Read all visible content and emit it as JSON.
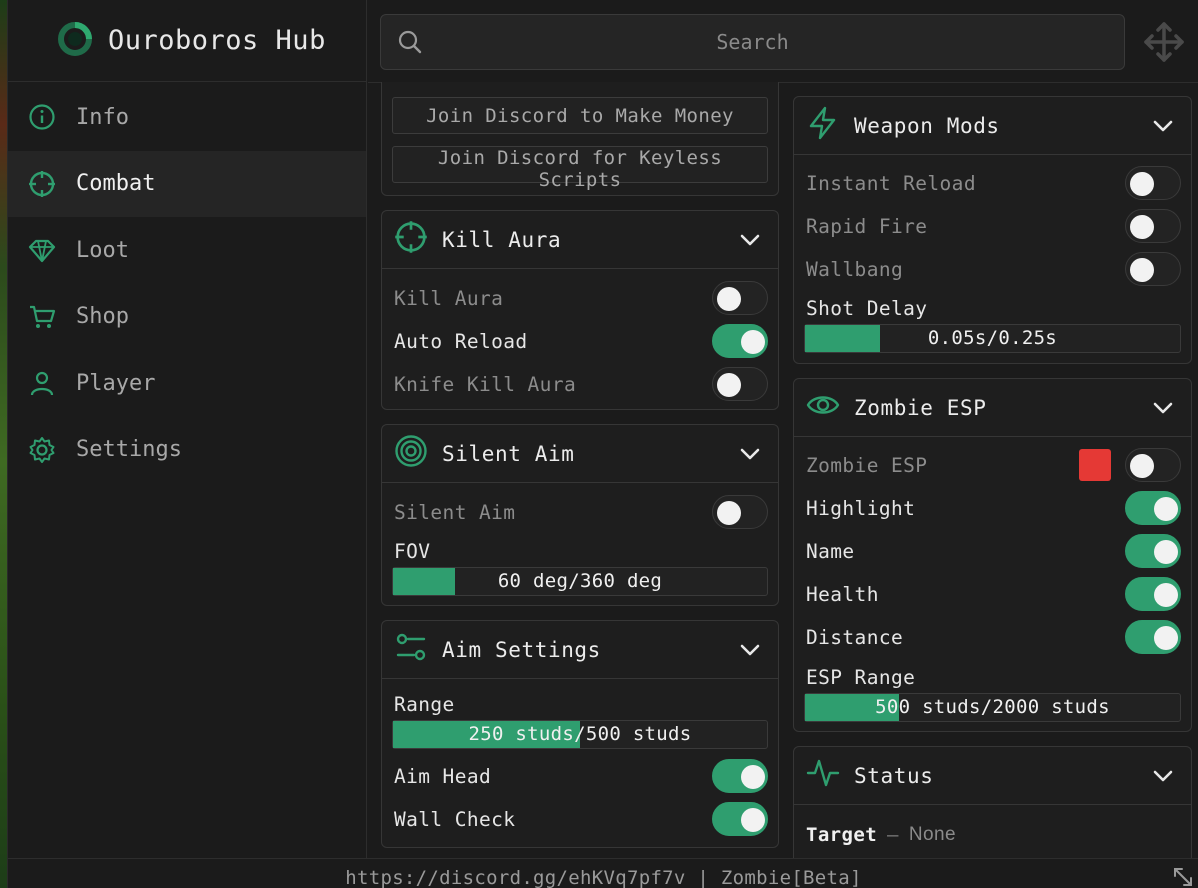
{
  "app": {
    "title": "Ouroboros Hub"
  },
  "search": {
    "placeholder": "Search"
  },
  "sidebar": {
    "items": [
      {
        "label": "Info",
        "icon": "info-icon"
      },
      {
        "label": "Combat",
        "icon": "crosshair-icon",
        "active": true
      },
      {
        "label": "Loot",
        "icon": "gem-icon"
      },
      {
        "label": "Shop",
        "icon": "cart-icon"
      },
      {
        "label": "Player",
        "icon": "user-icon"
      },
      {
        "label": "Settings",
        "icon": "gear-icon"
      }
    ]
  },
  "discord_panel": {
    "buttons": [
      "Join Discord to Make Money",
      "Join Discord for Keyless Scripts"
    ]
  },
  "kill_aura": {
    "title": "Kill Aura",
    "rows": [
      {
        "label": "Kill Aura",
        "on": false
      },
      {
        "label": "Auto Reload",
        "on": true
      },
      {
        "label": "Knife Kill Aura",
        "on": false
      }
    ]
  },
  "silent_aim": {
    "title": "Silent Aim",
    "rows": [
      {
        "label": "Silent Aim",
        "on": false
      }
    ],
    "fov": {
      "label": "FOV",
      "value_text": "60 deg/360 deg",
      "fraction": 0.167
    }
  },
  "aim_settings": {
    "title": "Aim Settings",
    "range": {
      "label": "Range",
      "value_text": "250 studs/500 studs",
      "fraction": 0.5
    },
    "rows": [
      {
        "label": "Aim Head",
        "on": true
      },
      {
        "label": "Wall Check",
        "on": true
      }
    ]
  },
  "weapon_mods": {
    "title": "Weapon Mods",
    "rows": [
      {
        "label": "Instant Reload",
        "on": false
      },
      {
        "label": "Rapid Fire",
        "on": false
      },
      {
        "label": "Wallbang",
        "on": false
      }
    ],
    "shot_delay": {
      "label": "Shot Delay",
      "value_text": "0.05s/0.25s",
      "fraction": 0.2
    }
  },
  "zombie_esp": {
    "title": "Zombie ESP",
    "color": "#e53935",
    "rows": [
      {
        "label": "Zombie ESP",
        "on": false
      },
      {
        "label": "Highlight",
        "on": true
      },
      {
        "label": "Name",
        "on": true
      },
      {
        "label": "Health",
        "on": true
      },
      {
        "label": "Distance",
        "on": true
      }
    ],
    "esp_range": {
      "label": "ESP Range",
      "value_text": "500 studs/2000 studs",
      "fraction": 0.25
    }
  },
  "status": {
    "title": "Status",
    "target_label": "Target",
    "target_sep": "–",
    "target_value": "None"
  },
  "footer": {
    "text": "https://discord.gg/ehKVq7pf7v | Zombie[Beta]"
  },
  "colors": {
    "accent": "#2f9e6f",
    "background": "#1b1b1b",
    "panel": "#1e1e1e"
  }
}
